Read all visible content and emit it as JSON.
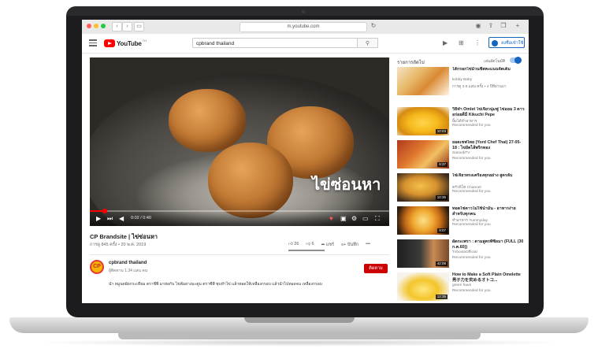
{
  "browser": {
    "url": "m.youtube.com"
  },
  "header": {
    "logo_text": "YouTube",
    "logo_sup": "TH",
    "search_value": "cpbrand thailand",
    "signin_label": "ลงชื่อเข้าใช้"
  },
  "video": {
    "overlay_text": "ไข่ซ่อนหา",
    "time": "0:02 / 0:40",
    "progress": 0.05,
    "title": "CP Brandsite | ไข่ซ่อนหา",
    "meta": "การดู 845 ครั้ง • 20 พ.ค. 2019",
    "likes": "26",
    "dislikes": "6",
    "share_label": "แชร์",
    "save_label": "บันทึก",
    "more_label": "•••"
  },
  "channel": {
    "avatar_text": "CP",
    "name": "cpbrand thailand",
    "subs": "ผู้ติดตาม 1.34 แสน คน",
    "subscribe_label": "ติดตาม",
    "description": "นำ หมูบดผัดกระเทียม ตราซีพี มาห่อกับ ไข่ต้มยางมะตูม ตราซีพี ชุบทำไข่ แล้วทอดให้เหลืองกรอบ แล้วนำไปทอดจน เหลืองกรอบ"
  },
  "sidebar": {
    "upnext_label": "รายการถัดไป",
    "autoplay_label": "เล่นอัตโนมัติ",
    "items": [
      {
        "title": "ไส้กรอกไข่ม้วนชีสคะแนนจัดเต็ม",
        "channel": "kobby Baby",
        "meta": "การดู 3.9 แสน ครั้ง • 4 ปีที่ผ่านมา",
        "duration": ""
      },
      {
        "title": "วิธีทำ Omlet ไข่เจียวนุ่มฟู ไข่ออม 3 ดาว อร่อยดีมี Kikuchi Pepe",
        "channel": "ยิ้มได้ทำอาหาร",
        "meta": "Recommended for you",
        "duration": "10:03"
      },
      {
        "title": "ยอดเชฟไทย (Yord Chef Thai) 27-05-18 : ไข่ยัดไส้พริกทอง",
        "channel": "SanookTV",
        "meta": "Recommended for you",
        "duration": "8:37"
      },
      {
        "title": "ไข่เจียวทรงเครื่องทุกอย่าง สูตรลับ",
        "channel": "ครัวพิโค Channel",
        "meta": "Recommended for you",
        "duration": "10:35"
      },
      {
        "title": "ทอดไข่ดาวไม่ใช้น้ำมัน - อาหารง่ายสำหรับทุกคน",
        "channel": "ทำอาหาร Yummyday",
        "meta": "Recommended for you",
        "duration": "9:07"
      },
      {
        "title": "ผัดกะเพรา : ตามสูตรที่ซื้อมา (FULL (30 ก.ค.60))",
        "channel": "TvboxtaOfficial",
        "meta": "Recommended for you",
        "duration": "42:08"
      },
      {
        "title": "How to Make a Soft Plain Omelette 男子力を究めるオトコ...",
        "channel": "green haus",
        "meta": "Recommended for you",
        "duration": "12:35"
      }
    ]
  }
}
